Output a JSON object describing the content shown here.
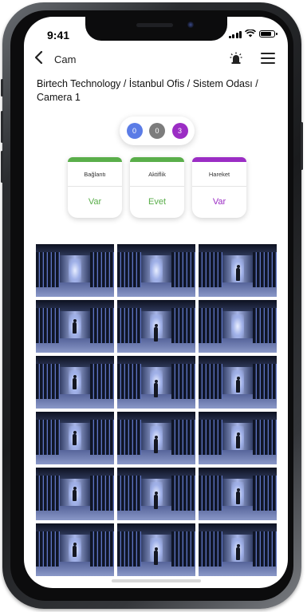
{
  "status_bar": {
    "time": "9:41",
    "battery_level": 0.85
  },
  "nav": {
    "title": "Cam",
    "alarm_icon": "siren-icon",
    "menu_icon": "hamburger-icon"
  },
  "breadcrumb": "Birtech Technology / İstanbul Ofis / Sistem Odası / Camera 1",
  "counters": [
    {
      "value": "0",
      "color": "#5b7ce6"
    },
    {
      "value": "0",
      "color": "#7c7c7c"
    },
    {
      "value": "3",
      "color": "#9b2dc4"
    }
  ],
  "cards": [
    {
      "label": "Bağlantı",
      "value": "Var",
      "color": "#5aae4a"
    },
    {
      "label": "Aktiflik",
      "value": "Evet",
      "color": "#5aae4a"
    },
    {
      "label": "Hareket",
      "value": "Var",
      "color": "#9b2dc4"
    }
  ],
  "thumbnails": [
    {
      "person": false
    },
    {
      "person": false
    },
    {
      "person": true
    },
    {
      "person": true
    },
    {
      "person": true
    },
    {
      "person": false
    },
    {
      "person": true
    },
    {
      "person": true
    },
    {
      "person": true
    },
    {
      "person": true
    },
    {
      "person": true
    },
    {
      "person": true
    },
    {
      "person": true
    },
    {
      "person": true
    },
    {
      "person": true
    },
    {
      "person": true
    },
    {
      "person": true
    },
    {
      "person": true
    }
  ]
}
